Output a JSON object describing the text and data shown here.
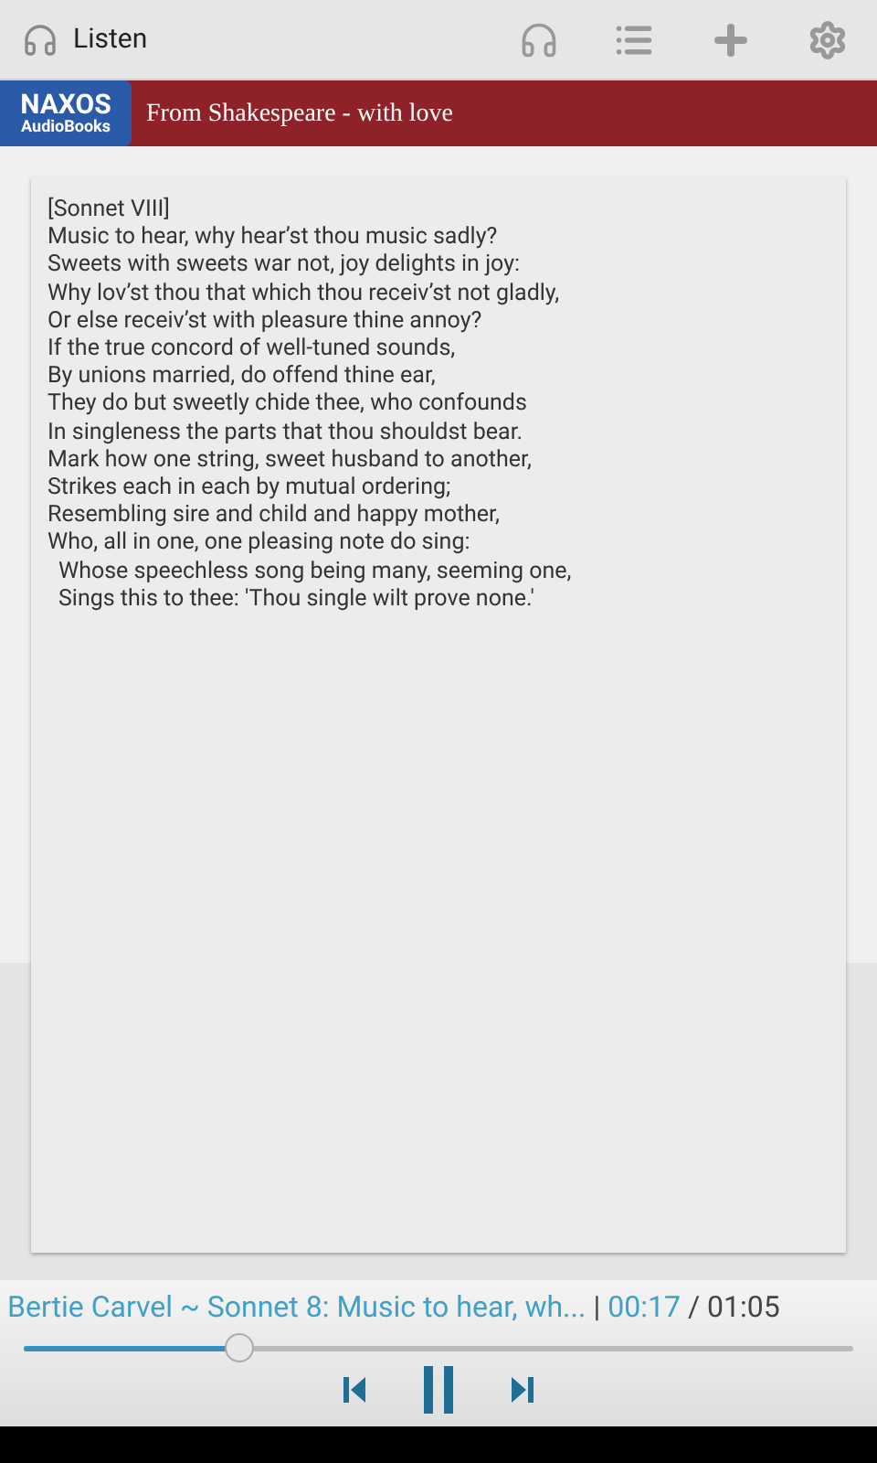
{
  "action_bar": {
    "title": "Listen"
  },
  "banner": {
    "logo_top": "NAXOS",
    "logo_bottom": "AudioBooks",
    "title": "From Shakespeare - with love"
  },
  "poem": {
    "lines": [
      {
        "text": "[Sonnet VIII]",
        "indented": false
      },
      {
        "text": "Music to hear, why hear’st thou music sadly?",
        "indented": false
      },
      {
        "text": "Sweets with sweets war not, joy delights in joy:",
        "indented": false
      },
      {
        "text": "Why lov’st thou that which thou receiv’st not gladly,",
        "indented": false
      },
      {
        "text": "Or else receiv’st with pleasure thine annoy?",
        "indented": false
      },
      {
        "text": "If the true concord of well-tuned sounds,",
        "indented": false
      },
      {
        "text": "By unions married, do offend thine ear,",
        "indented": false
      },
      {
        "text": "They do but sweetly chide thee, who confounds",
        "indented": false
      },
      {
        "text": "In singleness the parts that thou shouldst bear.",
        "indented": false
      },
      {
        "text": "Mark how one string, sweet husband to another,",
        "indented": false
      },
      {
        "text": "Strikes each in each by mutual ordering;",
        "indented": false
      },
      {
        "text": "Resembling sire and child and happy mother,",
        "indented": false
      },
      {
        "text": "Who, all in one, one pleasing note do sing:",
        "indented": false
      },
      {
        "text": "Whose speechless song being many, seeming one,",
        "indented": true
      },
      {
        "text": "Sings this to thee: 'Thou single wilt prove none.'",
        "indented": true
      }
    ]
  },
  "player": {
    "track": "Bertie Carvel ~ Sonnet 8: Music to hear, wh...",
    "separator": "|",
    "elapsed": "00:17",
    "total": "/ 01:05",
    "level": 0.26,
    "playing": true
  }
}
